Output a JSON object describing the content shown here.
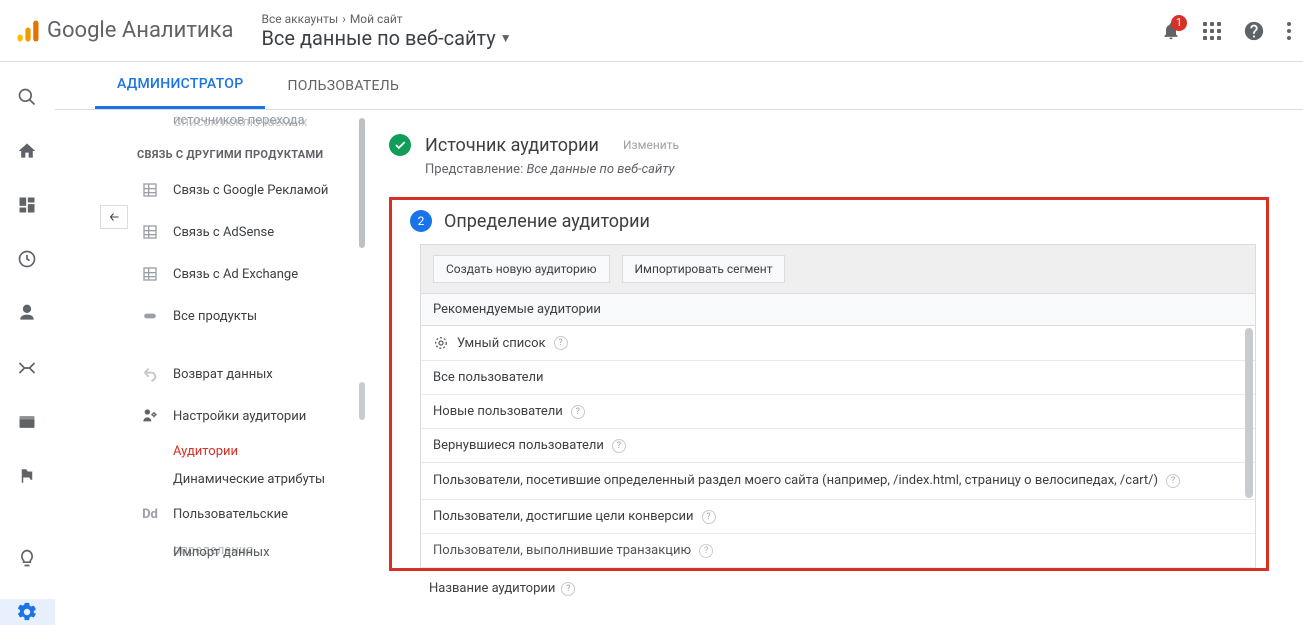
{
  "header": {
    "brand": "Google Аналитика",
    "path_part1": "Все аккаунты",
    "path_part2": "Мой сайт",
    "view_name": "Все данные по веб-сайту",
    "notification_count": "1"
  },
  "tabs": {
    "admin": "АДМИНИСТРАТОР",
    "user": "ПОЛЬЗОВАТЕЛЬ"
  },
  "sidebar": {
    "truncated1": "источников перехода",
    "truncated2": "Список исключаемых",
    "section_link": "СВЯЗЬ С ДРУГИМИ ПРОДУКТАМИ",
    "items": [
      "Связь с Google Рекламой",
      "Связь с AdSense",
      "Связь с Ad Exchange",
      "Все продукты",
      "Возврат данных",
      "Настройки аудитории",
      "Аудитории",
      "Динамические атрибуты",
      "Пользовательские",
      "определения",
      "Импорт данных"
    ]
  },
  "panel": {
    "step1": {
      "title": "Источник аудитории",
      "edit": "Изменить",
      "sub_label": "Представление:",
      "sub_value": "Все данные по веб-сайту"
    },
    "step2": {
      "number": "2",
      "title": "Определение аудитории",
      "btn_create": "Создать новую аудиторию",
      "btn_import": "Импортировать сегмент",
      "rec_header": "Рекомендуемые аудитории",
      "rows": [
        "Умный список",
        "Все пользователи",
        "Новые пользователи",
        "Вернувшиеся пользователи",
        "Пользователи, посетившие определенный раздел моего сайта (например, /index.html, страницу о велосипедах, /cart/)",
        "Пользователи, достигшие цели конверсии",
        "Пользователи, выполнившие транзакцию"
      ],
      "name_label": "Название аудитории"
    }
  }
}
